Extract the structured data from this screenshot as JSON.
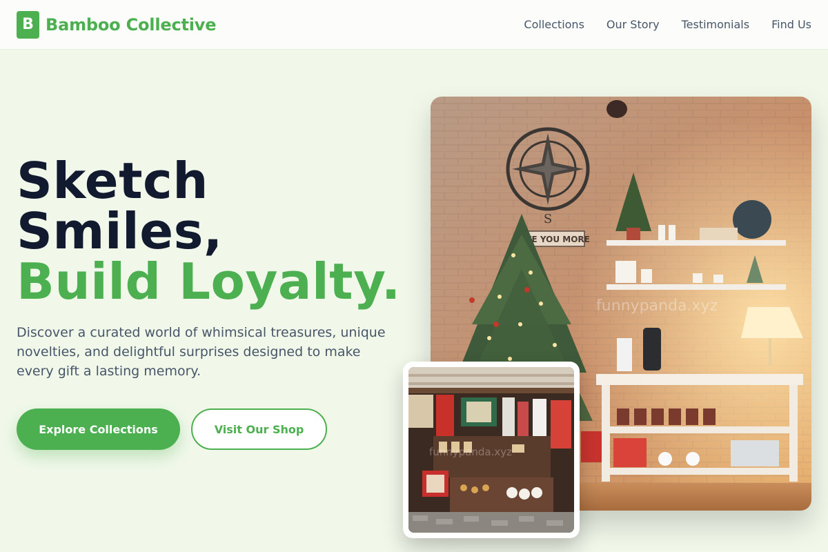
{
  "header": {
    "brand_mark": "B",
    "brand_name": "Bamboo Collective",
    "nav": [
      "Collections",
      "Our Story",
      "Testimonials",
      "Find Us"
    ]
  },
  "hero": {
    "title_line1": "Sketch",
    "title_line2": "Smiles,",
    "title_accent": "Build Loyalty.",
    "description": "Discover a curated world of whimsical treasures, unique novelties, and delightful surprises designed to make every gift a lasting memory.",
    "primary_button": "Explore Collections",
    "secondary_button": "Visit Our Shop"
  },
  "images": {
    "main_photo_sign": "LOVE YOU MORE",
    "main_photo_watermark": "funnypanda.xyz",
    "inset_photo_watermark": "funnypanda.xyz"
  },
  "colors": {
    "brand": "#4caf50",
    "page_background": "#f1f8ea",
    "heading": "#111a2e",
    "body_text": "#475569"
  },
  "icons": {
    "brand_logo": "letter-b-logo"
  }
}
